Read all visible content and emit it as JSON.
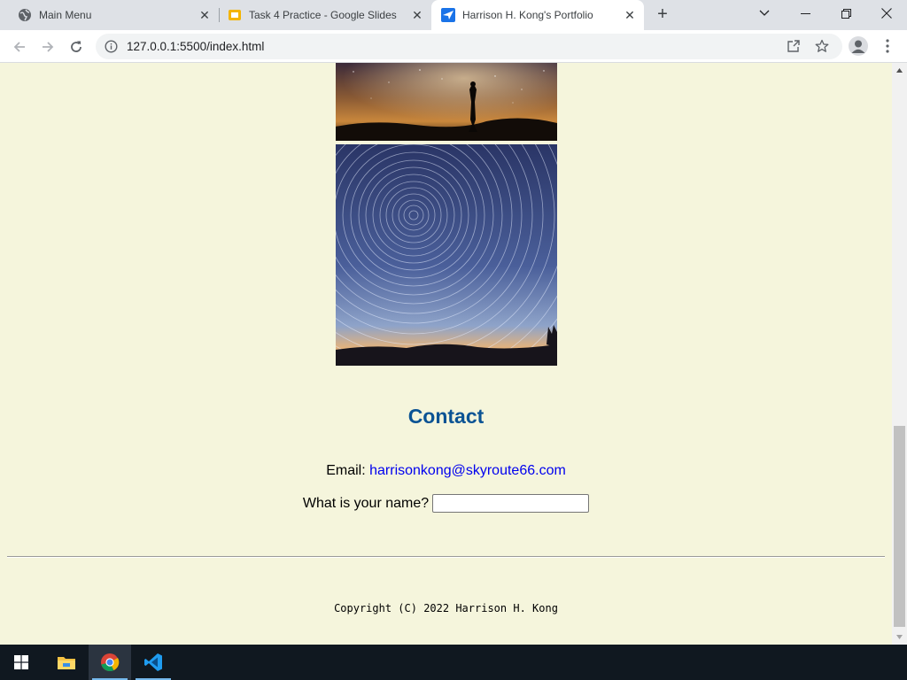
{
  "browser": {
    "tabs": [
      {
        "title": "Main Menu",
        "active": false,
        "icon": "globe-icon"
      },
      {
        "title": "Task 4 Practice - Google Slides",
        "active": false,
        "icon": "google-slides-icon"
      },
      {
        "title": "Harrison H. Kong's Portfolio",
        "active": true,
        "icon": "paper-plane-icon"
      }
    ],
    "new_tab_symbol": "+",
    "close_symbol": "✕",
    "url": "127.0.0.1:5500/index.html"
  },
  "page": {
    "contact_heading": "Contact",
    "email_label": "Email: ",
    "email_address": "harrisonkong@skyroute66.com",
    "name_prompt": "What is your name?",
    "name_value": "",
    "copyright": "Copyright (C) 2022 Harrison H. Kong"
  },
  "colors": {
    "page_background": "#f5f5dc",
    "heading": "#0b5394",
    "link": "#0000ee",
    "taskbar": "#101820"
  },
  "taskbar": {
    "items": [
      "windows-start-icon",
      "file-explorer-icon",
      "chrome-icon",
      "vscode-icon"
    ],
    "active": "chrome-icon"
  }
}
